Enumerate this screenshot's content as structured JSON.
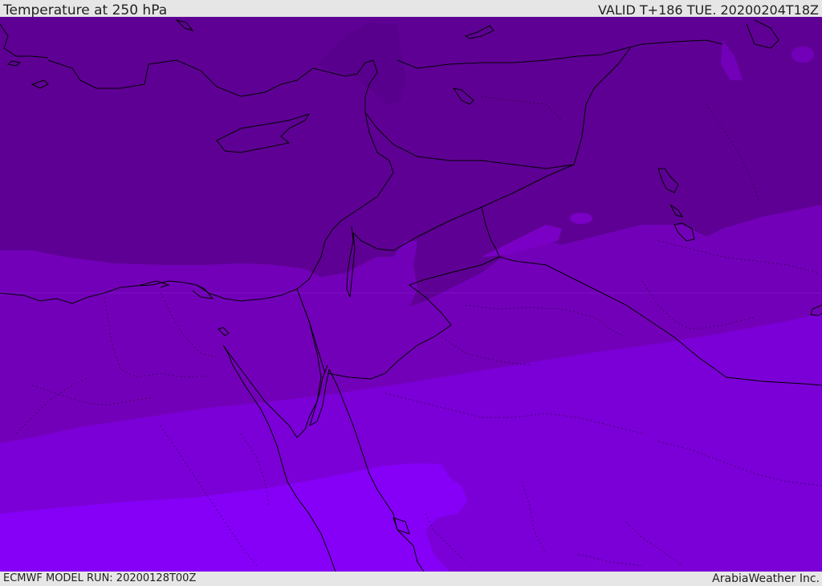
{
  "header": {
    "title": "Temperature at 250 hPa",
    "valid": "VALID T+186 TUE. 20200204T18Z"
  },
  "footer": {
    "model_run": "ECMWF MODEL RUN: 20200128T00Z",
    "credit": "ArabiaWeather Inc."
  },
  "colors": {
    "band_coldest": "#5f0095",
    "band_cold": "#6a00a8",
    "band_mid": "#7300b9",
    "band_warm": "#7b00d7",
    "band_warmest": "#8600f8",
    "coast": "#000000"
  }
}
